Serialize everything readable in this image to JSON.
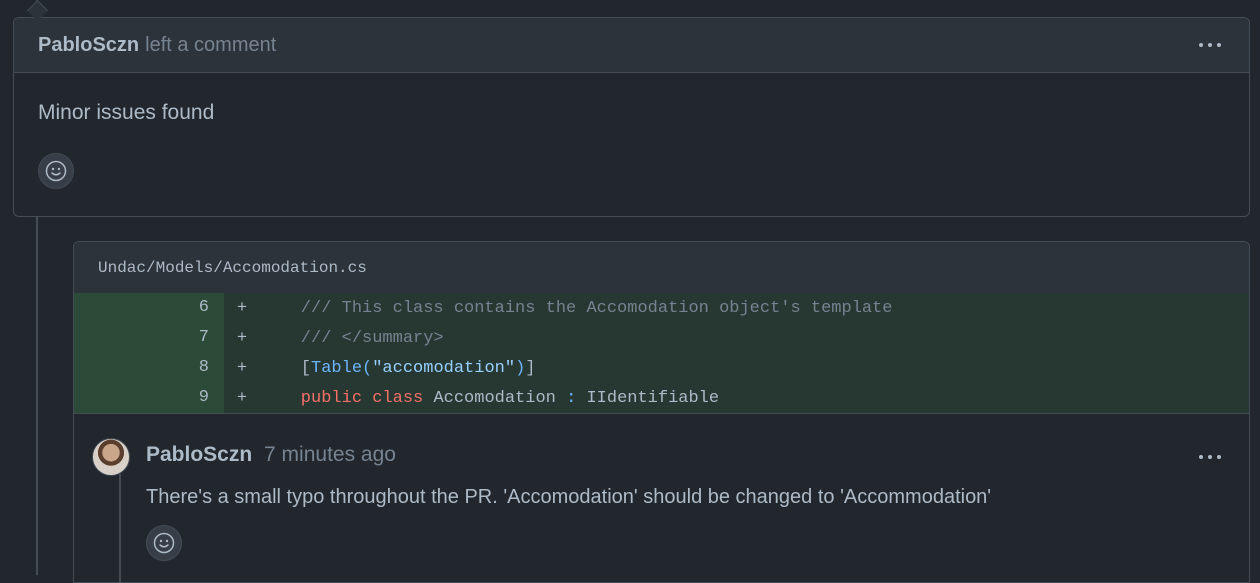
{
  "review": {
    "author": "PabloSczn",
    "action": "left a comment",
    "body": "Minor issues found"
  },
  "file": {
    "path": "Undac/Models/Accomodation.cs",
    "lines": [
      {
        "num": "6",
        "mark": "+",
        "parts": [
          {
            "cls": "c-comment",
            "text": "    /// This class contains the Accomodation object's template"
          }
        ]
      },
      {
        "num": "7",
        "mark": "+",
        "parts": [
          {
            "cls": "c-comment",
            "text": "    /// </summary>"
          }
        ]
      },
      {
        "num": "8",
        "mark": "+",
        "parts": [
          {
            "cls": "c-plain",
            "text": "    ["
          },
          {
            "cls": "c-type",
            "text": "Table("
          },
          {
            "cls": "c-string",
            "text": "\"accomodation\""
          },
          {
            "cls": "c-type",
            "text": ")"
          },
          {
            "cls": "c-plain",
            "text": "]"
          }
        ]
      },
      {
        "num": "9",
        "mark": "+",
        "parts": [
          {
            "cls": "c-keyword",
            "text": "    public class "
          },
          {
            "cls": "c-plain",
            "text": "Accomodation "
          },
          {
            "cls": "c-type",
            "text": ": "
          },
          {
            "cls": "c-plain",
            "text": "IIdentifiable"
          }
        ]
      }
    ]
  },
  "comment": {
    "author": "PabloSczn",
    "time": "7 minutes ago",
    "body": "There's a small typo throughout the PR. 'Accomodation' should be changed to 'Accommodation'"
  },
  "colors": {
    "background": "#22272e",
    "header": "#2d333b",
    "border": "#444c56",
    "diff_add": "#273732",
    "diff_add_num": "#2b4a37"
  },
  "icons": [
    "kebab-menu-icon",
    "smiley-icon"
  ]
}
